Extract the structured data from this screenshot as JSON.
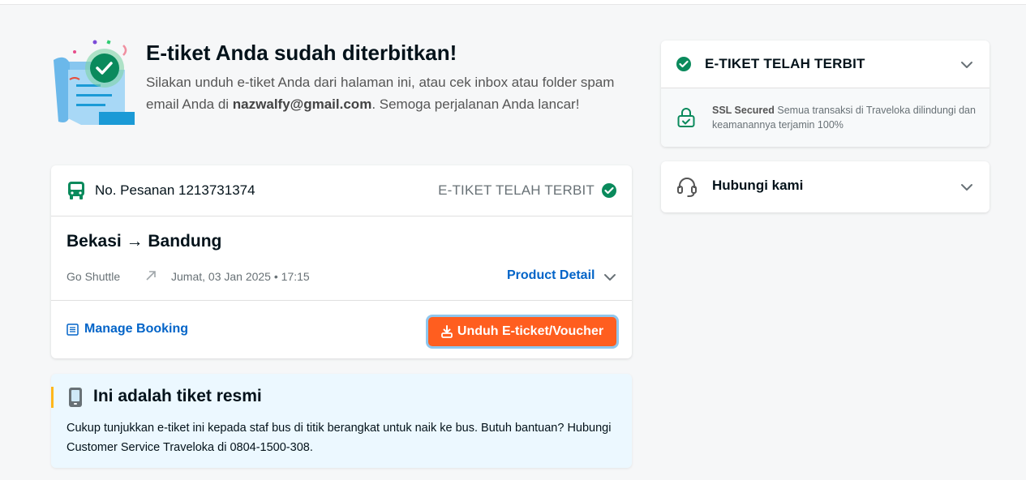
{
  "hero": {
    "title": "E-tiket Anda sudah diterbitkan!",
    "desc_pre": "Silakan unduh e-tiket Anda dari halaman ini, atau cek inbox atau folder spam email Anda di ",
    "email": "nazwalfy@gmail.com",
    "desc_post": ". Semoga perjalanan Anda lancar!"
  },
  "booking": {
    "order_label": "No. Pesanan 1213731374",
    "status": "E-TIKET TELAH TERBIT",
    "route": "Bekasi → Bandung",
    "operator": "Go Shuttle",
    "departure": "Jumat, 03 Jan 2025 • 17:15",
    "product_detail": "Product Detail",
    "manage_booking": "Manage Booking",
    "download_button": "Unduh E-ticket/Voucher"
  },
  "info": {
    "title": "Ini adalah tiket resmi",
    "text": "Cukup tunjukkan e-tiket ini kepada staf bus di titik berangkat untuk naik ke bus. Butuh bantuan? Hubungi Customer Service Traveloka di 0804-1500-308."
  },
  "side": {
    "status_title": "E-TIKET TELAH TERBIT",
    "ssl_label": "SSL Secured",
    "ssl_text": " Semua transaksi di Traveloka dilindungi dan keamanannya terjamin 100%",
    "contact": "Hubungi kami"
  },
  "colors": {
    "accent_blue": "#0264c8",
    "download_orange": "#ff5e1f",
    "success_green": "#0a8a5c",
    "info_bg": "#ecf8ff",
    "info_bar": "#ffb71b"
  },
  "icons": [
    "ticket-illustration",
    "bus-icon",
    "check-circle-icon",
    "arrow-up-right-icon",
    "chevron-down-icon",
    "manage-booking-icon",
    "download-icon",
    "phone-icon",
    "lock-shield-icon",
    "headset-icon"
  ]
}
